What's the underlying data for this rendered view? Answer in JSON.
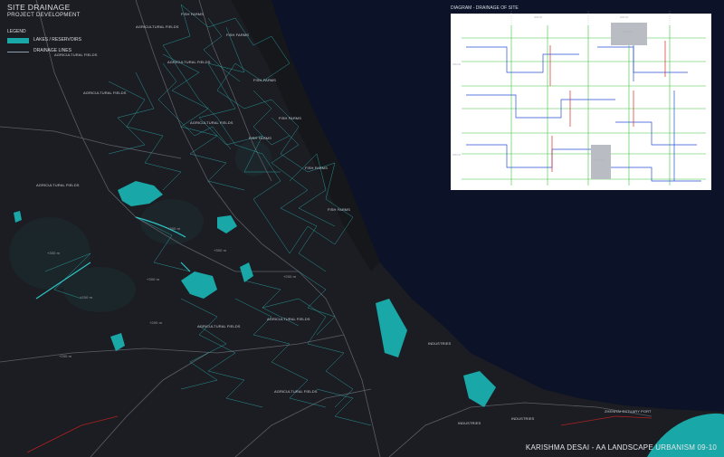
{
  "title": "SITE DRAINAGE",
  "subtitle": "PROJECT DEVELOPMENT",
  "legend": {
    "heading": "LEGEND",
    "lakes": "LAKES / RESERVOIRS",
    "drainage": "DRAINAGE LINES"
  },
  "diagram": {
    "title": "DIAGRAM - DRAINAGE OF SITE",
    "labels": [
      "VILLAGE",
      "VILLAGE",
      "3000.00",
      "4000.00",
      "3000.00",
      "2000.00"
    ]
  },
  "map_labels": [
    "FISH FARMS",
    "AGRICULTURAL FIELDS",
    "FISH FARMS",
    "AGRICULTURAL FIELDS",
    "AGRICULTURAL FIELDS",
    "FISH FARMS",
    "AGRICULTURAL FIELDS",
    "FISH FARMS",
    "AGRICULTURAL FIELDS",
    "FISH FARMS",
    "FISH FARMS",
    "AGRICULTURAL FIELDS",
    "FISH FARMS",
    "+300 m",
    "+300 m",
    "+300 m",
    "+300 m",
    "+200 m",
    "+200 m",
    "+200 m",
    "+200 m",
    "AGRICULTURAL FIELDS",
    "AGRICULTURAL FIELDS",
    "AGRICULTURAL FIELDS",
    "INDUSTRIES",
    "INDUSTRIES",
    "INDUSTRIES",
    "ZHENHAI ESTUARY PORT"
  ],
  "credit": "KARISHMA DESAI - AA LANDSCAPE URBANISM 09-10",
  "colors": {
    "background": "#0b0e14",
    "land": "#1b1d22",
    "sea": "#0c1328",
    "lake": "#1aa7a7",
    "drainage": "#2ec4c4",
    "roads": "#5a5e66",
    "diagram_bg": "#ffffff",
    "diagram_green": "#3ec43e",
    "diagram_blue": "#2b4fd6",
    "diagram_red": "#d62b2b"
  }
}
